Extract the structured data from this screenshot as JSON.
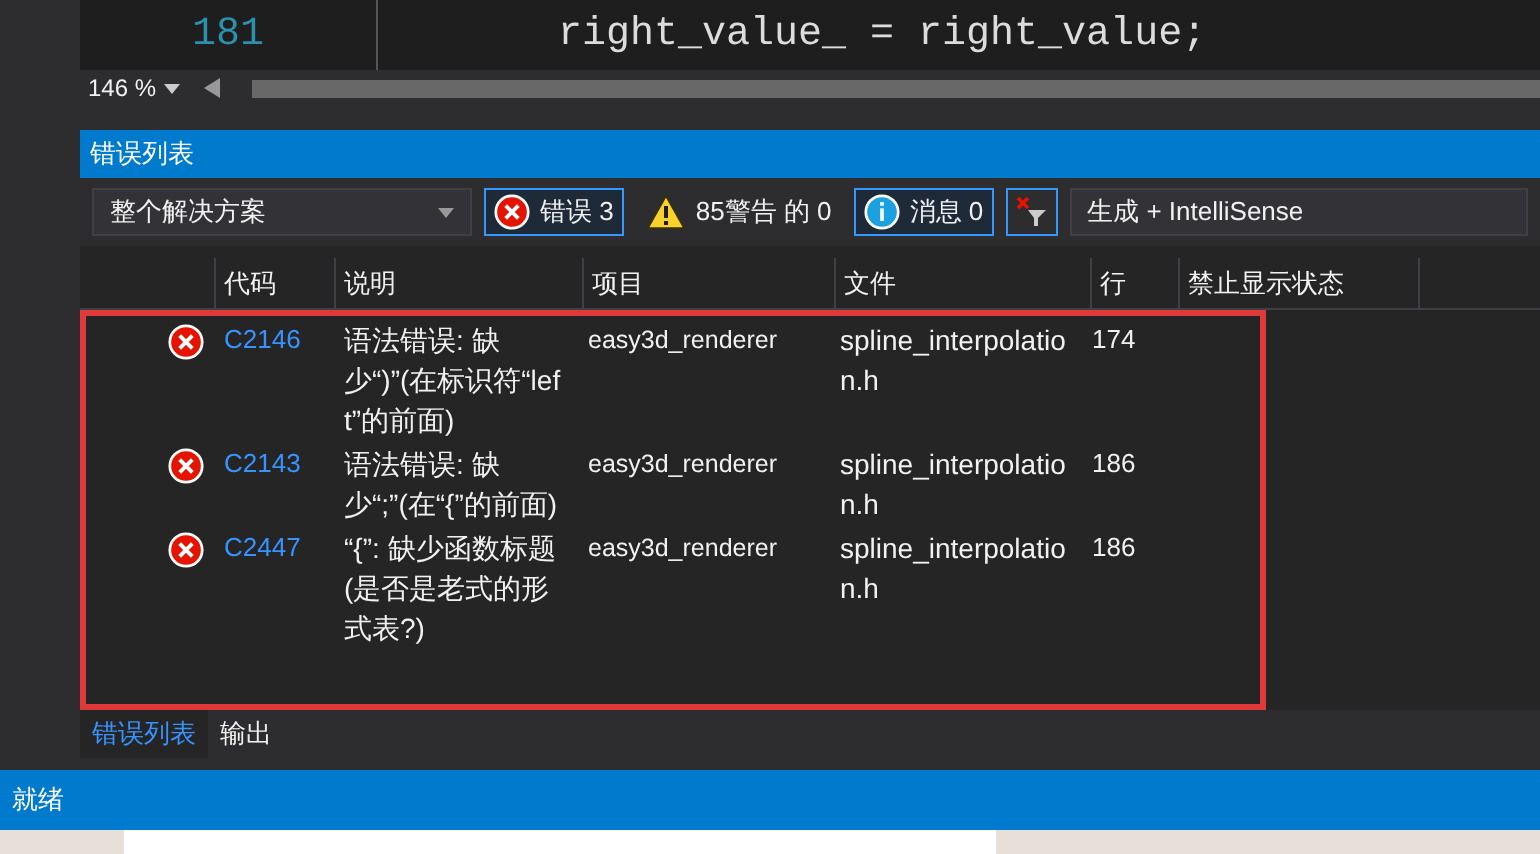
{
  "editor": {
    "line_number": "181",
    "code": "right_value_ = right_value;",
    "zoom": "146 %"
  },
  "panel": {
    "title": "错误列表"
  },
  "toolbar": {
    "scope": "整个解决方案",
    "filters": [
      {
        "kind": "error",
        "label": "错误 3",
        "selected": true
      },
      {
        "kind": "warning",
        "label": "85警告 的 0",
        "selected": false
      },
      {
        "kind": "info",
        "label": "消息 0",
        "selected": true
      }
    ],
    "source": "生成 + IntelliSense"
  },
  "table": {
    "columns": [
      "代码",
      "说明",
      "项目",
      "文件",
      "行",
      "禁止显示状态"
    ],
    "rows": [
      {
        "code": "C2146",
        "description": "语法错误: 缺少“)”(在标识符“left”的前面)",
        "project": "easy3d_renderer",
        "file": "spline_interpolation.h",
        "line": "174"
      },
      {
        "code": "C2143",
        "description": "语法错误: 缺少“;”(在“{”的前面)",
        "project": "easy3d_renderer",
        "file": "spline_interpolation.h",
        "line": "186"
      },
      {
        "code": "C2447",
        "description": "“{”: 缺少函数标题(是否是老式的形式表?)",
        "project": "easy3d_renderer",
        "file": "spline_interpolation.h",
        "line": "186"
      }
    ]
  },
  "bottom_tabs": [
    {
      "label": "错误列表",
      "selected": true
    },
    {
      "label": "输出",
      "selected": false
    }
  ],
  "status_bar": {
    "text": "就绪"
  }
}
